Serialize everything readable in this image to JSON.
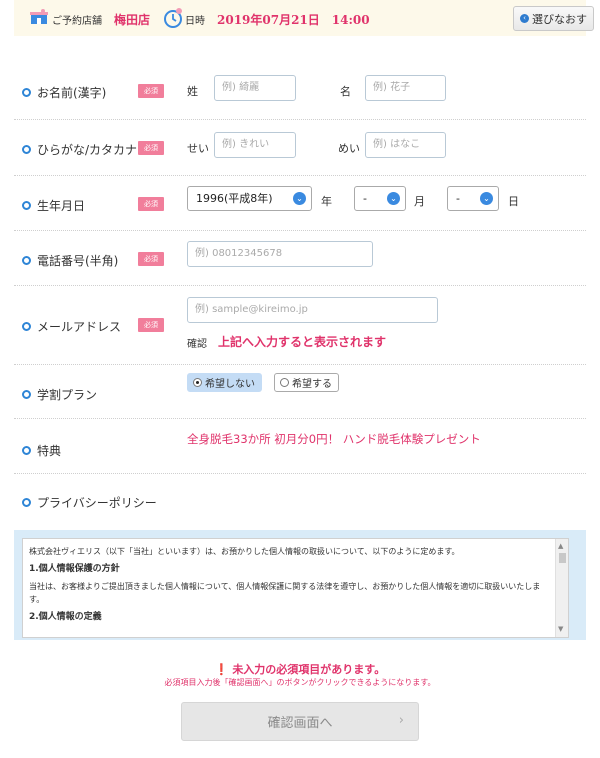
{
  "header": {
    "shop_label": "ご予約店舗",
    "shop_value": "梅田店",
    "datetime_label": "日時",
    "datetime_value": "2019年07月21日　14:00",
    "back_button": "選びなおす"
  },
  "required_badge": "必須",
  "form": {
    "name": {
      "label": "お名前(漢字)",
      "sei_label": "姓",
      "sei_placeholder": "例) 綺麗",
      "mei_label": "名",
      "mei_placeholder": "例) 花子"
    },
    "kana": {
      "label": "ひらがな/カタカナ",
      "sei_label": "せい",
      "sei_placeholder": "例) きれい",
      "mei_label": "めい",
      "mei_placeholder": "例) はなこ"
    },
    "birthday": {
      "label": "生年月日",
      "year_value": "1996(平成8年)",
      "year_unit": "年",
      "month_value": "-",
      "month_unit": "月",
      "day_value": "-",
      "day_unit": "日"
    },
    "phone": {
      "label": "電話番号(半角)",
      "placeholder": "例) 08012345678"
    },
    "email": {
      "label": "メールアドレス",
      "placeholder": "例) sample@kireimo.jp",
      "confirm_label": "確認",
      "confirm_message": "上記へ入力すると表示されます"
    },
    "student": {
      "label": "学割プラン",
      "option_no": "希望しない",
      "option_yes": "希望する",
      "selected": "希望しない"
    },
    "benefit": {
      "label": "特典",
      "text": "全身脱毛33か所 初月分0円！ ハンド脱毛体験プレゼント"
    },
    "privacy": {
      "label": "プライバシーポリシー"
    }
  },
  "policy": {
    "intro": "株式会社ヴィエリス（以下「当社」といいます）は、お預かりした個人情報の取扱いについて、以下のように定めます。",
    "heading1": "1.個人情報保護の方針",
    "body1": "当社は、お客様よりご提出頂きました個人情報について、個人情報保護に関する法律を遵守し、お預かりした個人情報を適切に取扱いいたします。",
    "heading2": "2.個人情報の定義"
  },
  "errors": {
    "main": "未入力の必須項目があります。",
    "sub": "必須項目入力後「確認画面へ」のボタンがクリックできるようになります。"
  },
  "confirm_button": "確認画面へ",
  "colors": {
    "accent_pink": "#e0336b",
    "badge_pink": "#f17e9b",
    "blue": "#2e85d6",
    "header_bg": "#fdf9ea"
  },
  "icons": [
    "shop-icon",
    "clock-icon",
    "chevron-left-icon",
    "chevron-down-icon",
    "alert-icon",
    "chevron-right-icon"
  ]
}
